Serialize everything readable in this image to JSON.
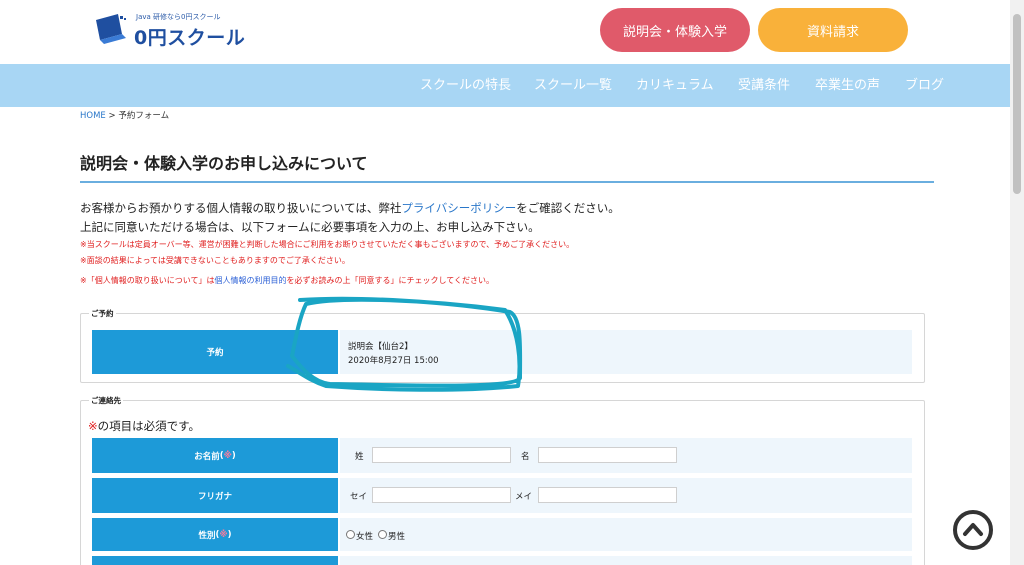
{
  "header": {
    "logo_tagline": "Java 研修なら0円スクール",
    "logo_text": "0円スクール",
    "seminar_button": "説明会・体験入学",
    "docs_button": "資料請求"
  },
  "nav": {
    "items": [
      {
        "label": "スクールの特長"
      },
      {
        "label": "スクール一覧"
      },
      {
        "label": "カリキュラム"
      },
      {
        "label": "受講条件"
      },
      {
        "label": "卒業生の声"
      },
      {
        "label": "ブログ"
      }
    ]
  },
  "breadcrumb": {
    "home": "HOME",
    "separator": ">",
    "current": "予約フォーム"
  },
  "page": {
    "title": "説明会・体験入学のお申し込みについて",
    "intro1_before": "お客様からお預かりする個人情報の取り扱いについては、弊社",
    "intro1_link": "プライバシーポリシー",
    "intro1_after": "をご確認ください。",
    "intro2": "上記に同意いただける場合は、以下フォームに必要事項を入力の上、お申し込み下さい。",
    "note1": "※当スクールは定員オーバー等、運営が困難と判断した場合にご利用をお断りさせていただく事もございますので、予めご了承ください。",
    "note2": "※面談の結果によっては受講できないこともありますのでご了承ください。",
    "note3_before": "※「個人情報の取り扱いについて」は",
    "note3_link": "個人情報の利用目的",
    "note3_after": "を必ずお読みの上「同意する」にチェックしてください。"
  },
  "reservation": {
    "legend": "ご予約",
    "label": "予約",
    "event": "説明会【仙台2】",
    "datetime": "2020年8月27日 15:00"
  },
  "contact": {
    "legend": "ご連絡先",
    "required_mark": "※",
    "required_note": "の項目は必須です。",
    "name_label": "お名前",
    "req_symbol": "※",
    "last_name_label": "姓",
    "first_name_label": "名",
    "kana_label": "フリガナ",
    "last_kana_label": "セイ",
    "first_kana_label": "メイ",
    "gender_label": "性別",
    "gender_female": "女性",
    "gender_male": "男性"
  },
  "colors": {
    "nav_bg": "#a8d6f4",
    "label_bg": "#1d9ad8",
    "seminar_btn": "#e05a6a",
    "docs_btn": "#f9b13a",
    "annotation": "#1aa5c4"
  },
  "icons": {
    "back_to_top": "chevron-up-circle-icon",
    "logo": "laptop-logo-icon"
  }
}
